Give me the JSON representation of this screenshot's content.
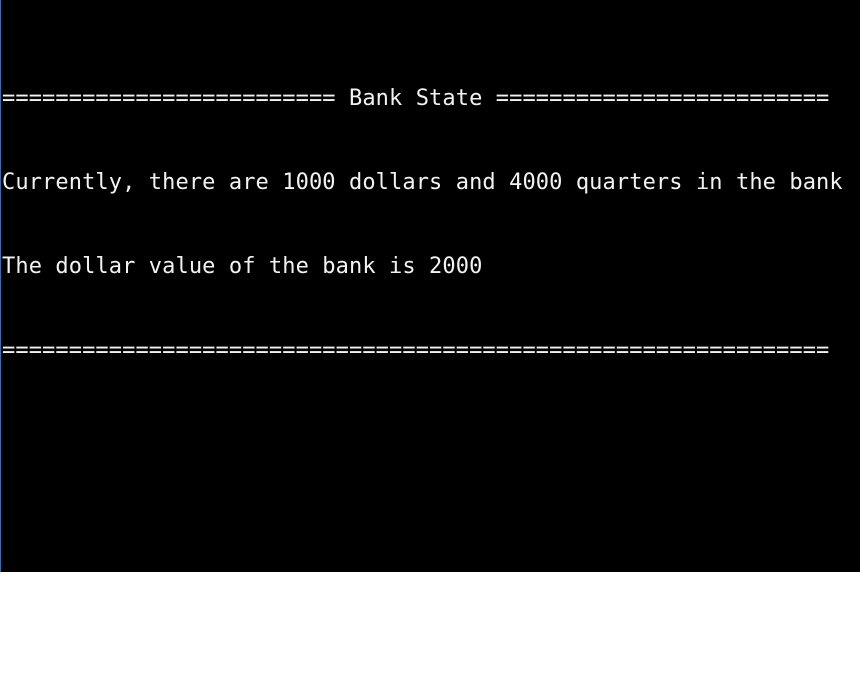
{
  "console": {
    "lines": [
      "========================= Bank State =========================",
      "Currently, there are 1000 dollars and 4000 quarters in the bank",
      "The dollar value of the bank is 2000",
      "=============================================================="
    ]
  },
  "colors": {
    "console_background": "#000000",
    "console_text": "#f2f2f2",
    "page_background": "#ffffff"
  }
}
